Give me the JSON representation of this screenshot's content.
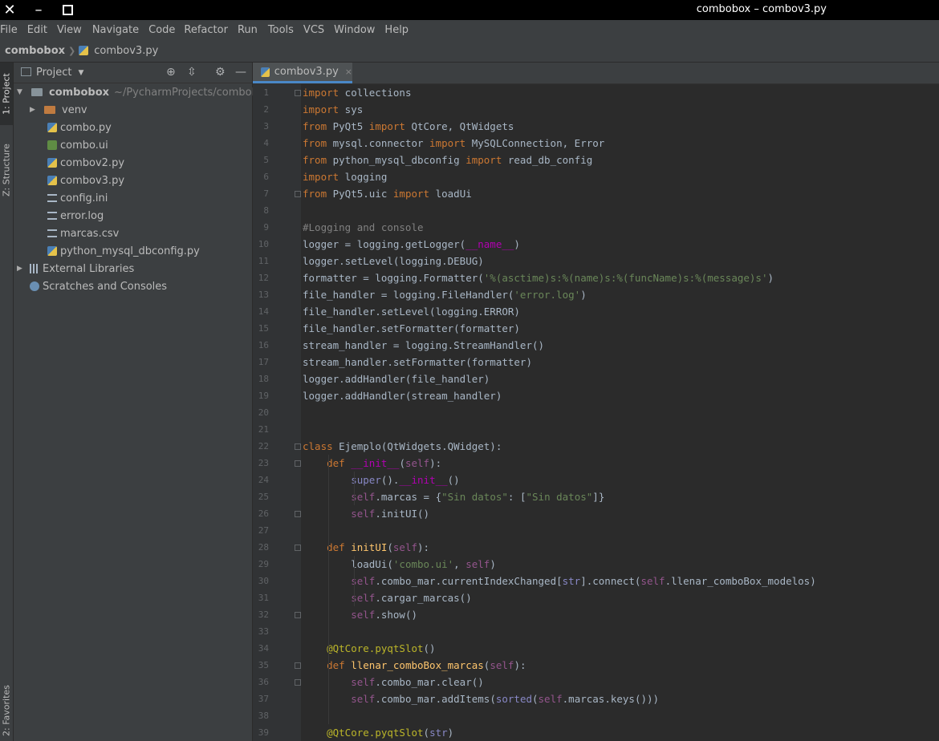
{
  "window": {
    "title": "combobox – combov3.py"
  },
  "menu": [
    "File",
    "Edit",
    "View",
    "Navigate",
    "Code",
    "Refactor",
    "Run",
    "Tools",
    "VCS",
    "Window",
    "Help"
  ],
  "nav": {
    "project": "combobox",
    "file": "combov3.py"
  },
  "side_tabs": {
    "project": "1: Project",
    "structure": "Z: Structure",
    "favorites": "2: Favorites"
  },
  "project_panel": {
    "title": "Project",
    "tree": [
      {
        "label": "combobox",
        "extra": "~/PycharmProjects/combobox",
        "icon": "folder-icon",
        "depth": 0,
        "arrow": "▼"
      },
      {
        "label": "venv",
        "icon": "folder-excluded-icon",
        "depth": 1,
        "arrow": "▶"
      },
      {
        "label": "combo.py",
        "icon": "python-file-icon",
        "depth": 2
      },
      {
        "label": "combo.ui",
        "icon": "ui-file-icon",
        "depth": 2
      },
      {
        "label": "combov2.py",
        "icon": "python-file-icon",
        "depth": 2
      },
      {
        "label": "combov3.py",
        "icon": "python-file-icon",
        "depth": 2
      },
      {
        "label": "config.ini",
        "icon": "text-file-icon",
        "depth": 2
      },
      {
        "label": "error.log",
        "icon": "text-file-icon",
        "depth": 2
      },
      {
        "label": "marcas.csv",
        "icon": "text-file-icon",
        "depth": 2
      },
      {
        "label": "python_mysql_dbconfig.py",
        "icon": "python-file-icon",
        "depth": 2
      },
      {
        "label": "External Libraries",
        "icon": "library-icon",
        "depth": 0,
        "arrow": "▶"
      },
      {
        "label": "Scratches and Consoles",
        "icon": "scratch-icon",
        "depth": 0
      }
    ]
  },
  "editor": {
    "tab": {
      "label": "combov3.py",
      "close": "×"
    },
    "line_numbers": [
      "1",
      "2",
      "3",
      "4",
      "5",
      "6",
      "7",
      "8",
      "9",
      "10",
      "11",
      "12",
      "13",
      "14",
      "15",
      "16",
      "17",
      "18",
      "19",
      "20",
      "21",
      "22",
      "23",
      "24",
      "25",
      "26",
      "27",
      "28",
      "29",
      "30",
      "31",
      "32",
      "33",
      "34",
      "35",
      "36",
      "37",
      "38",
      "39"
    ],
    "lines": [
      "import collections",
      "import sys",
      "from PyQt5 import QtCore, QtWidgets",
      "from mysql.connector import MySQLConnection, Error",
      "from python_mysql_dbconfig import read_db_config",
      "import logging",
      "from PyQt5.uic import loadUi",
      "",
      "#Logging and console",
      "logger = logging.getLogger(__name__)",
      "logger.setLevel(logging.DEBUG)",
      "formatter = logging.Formatter('%(asctime)s:%(name)s:%(funcName)s:%(message)s')",
      "file_handler = logging.FileHandler('error.log')",
      "file_handler.setLevel(logging.ERROR)",
      "file_handler.setFormatter(formatter)",
      "stream_handler = logging.StreamHandler()",
      "stream_handler.setFormatter(formatter)",
      "logger.addHandler(file_handler)",
      "logger.addHandler(stream_handler)",
      "",
      "",
      "class Ejemplo(QtWidgets.QWidget):",
      "    def __init__(self):",
      "        super().__init__()",
      "        self.marcas = {\"Sin datos\": [\"Sin datos\"]}",
      "        self.initUI()",
      "",
      "    def initUI(self):",
      "        loadUi('combo.ui', self)",
      "        self.combo_mar.currentIndexChanged[str].connect(self.llenar_comboBox_modelos)",
      "        self.cargar_marcas()",
      "        self.show()",
      "",
      "    @QtCore.pyqtSlot()",
      "    def llenar_comboBox_marcas(self):",
      "        self.combo_mar.clear()",
      "        self.combo_mar.addItems(sorted(self.marcas.keys()))",
      "",
      "    @QtCore.pyqtSlot(str)"
    ]
  }
}
